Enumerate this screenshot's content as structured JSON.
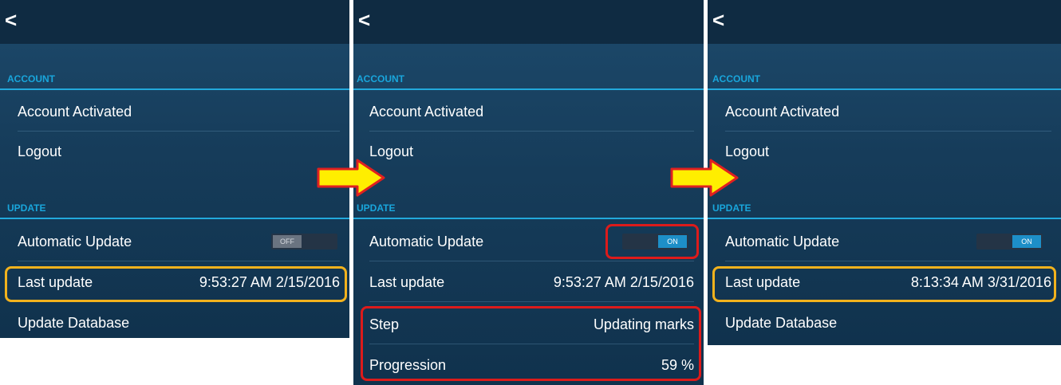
{
  "nav": {
    "back_glyph": "<"
  },
  "panels": [
    {
      "account_header": "ACCOUNT",
      "account_status": "Account Activated",
      "logout": "Logout",
      "update_header": "UPDATE",
      "auto_update": {
        "label": "Automatic Update",
        "state": "OFF"
      },
      "last_update": {
        "label": "Last update",
        "value": "9:53:27 AM 2/15/2016"
      },
      "update_database": "Update Database"
    },
    {
      "account_header": "ACCOUNT",
      "account_status": "Account Activated",
      "logout": "Logout",
      "update_header": "UPDATE",
      "auto_update": {
        "label": "Automatic Update",
        "state": "ON"
      },
      "last_update": {
        "label": "Last update",
        "value": "9:53:27 AM 2/15/2016"
      },
      "step": {
        "label": "Step",
        "value": "Updating marks"
      },
      "progression": {
        "label": "Progression",
        "value": "59 %"
      }
    },
    {
      "account_header": "ACCOUNT",
      "account_status": "Account Activated",
      "logout": "Logout",
      "update_header": "UPDATE",
      "auto_update": {
        "label": "Automatic Update",
        "state": "ON"
      },
      "last_update": {
        "label": "Last update",
        "value": "8:13:34 AM 3/31/2016"
      },
      "update_database": "Update Database"
    }
  ],
  "colors": {
    "highlight_orange": "#f2b21d",
    "highlight_red": "#dc1b1b",
    "section_accent": "#19a6dc",
    "toggle_on": "#1d8fc8",
    "arrow_fill": "#ffee00",
    "arrow_outline": "#e02020"
  }
}
